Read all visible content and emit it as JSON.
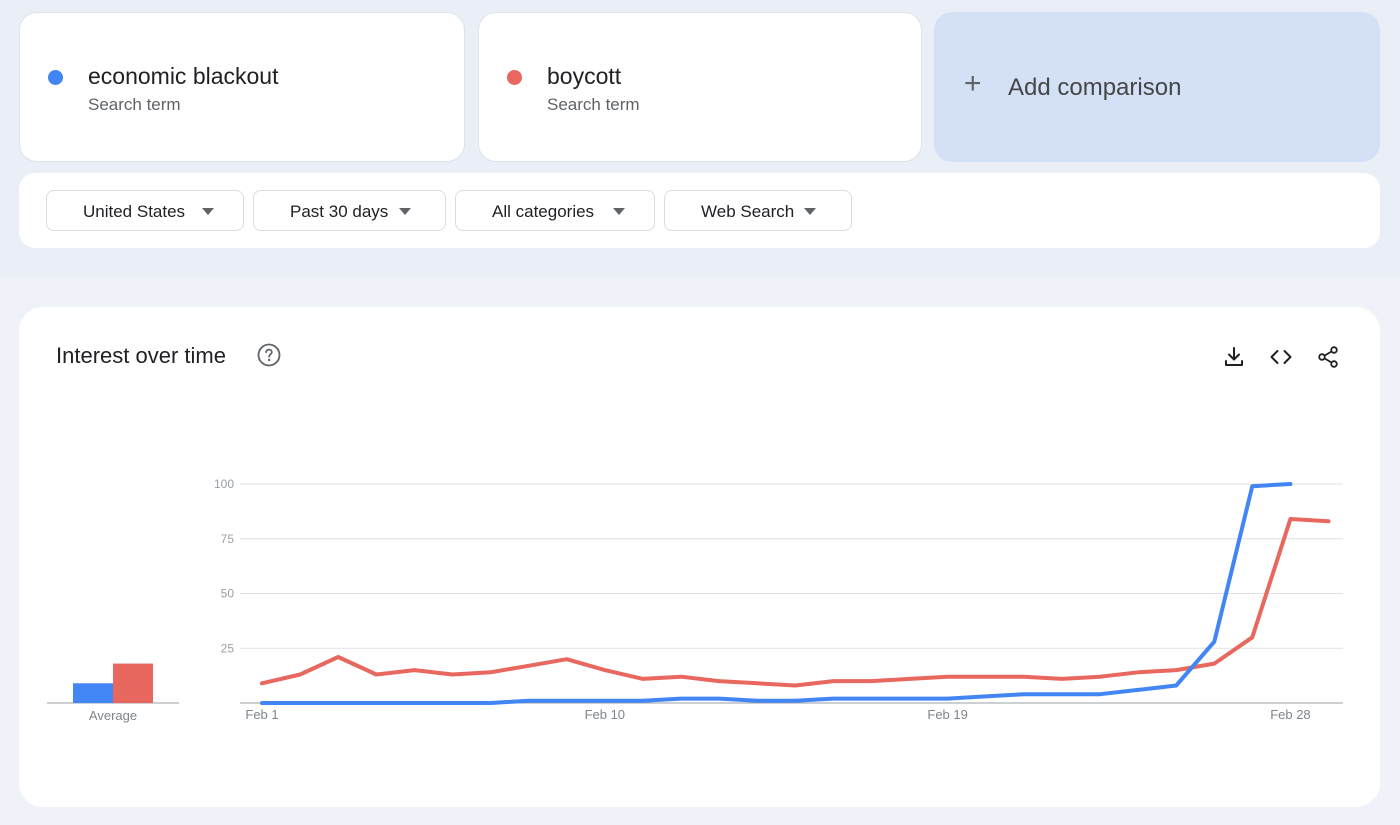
{
  "terms": [
    {
      "name": "economic blackout",
      "type": "Search term",
      "color": "#4285f4"
    },
    {
      "name": "boycott",
      "type": "Search term",
      "color": "#e8675e"
    }
  ],
  "add_comparison": {
    "icon": "plus-icon",
    "label": "Add comparison"
  },
  "filters": [
    {
      "label": "United States"
    },
    {
      "label": "Past 30 days"
    },
    {
      "label": "All categories"
    },
    {
      "label": "Web Search"
    }
  ],
  "chart_panel": {
    "title": "Interest over time",
    "icons": [
      "help-icon",
      "download-icon",
      "embed-icon",
      "share-icon"
    ]
  },
  "chart_data": {
    "type": "line",
    "title": "",
    "xlabel": "",
    "ylabel": "",
    "ylim": [
      0,
      100
    ],
    "yticks": [
      25,
      50,
      75,
      100
    ],
    "grid": true,
    "x": [
      "Feb 1",
      "Feb 2",
      "Feb 3",
      "Feb 4",
      "Feb 5",
      "Feb 6",
      "Feb 7",
      "Feb 8",
      "Feb 9",
      "Feb 10",
      "Feb 11",
      "Feb 12",
      "Feb 13",
      "Feb 14",
      "Feb 15",
      "Feb 16",
      "Feb 17",
      "Feb 18",
      "Feb 19",
      "Feb 20",
      "Feb 21",
      "Feb 22",
      "Feb 23",
      "Feb 24",
      "Feb 25",
      "Feb 26",
      "Feb 27",
      "Feb 28",
      "Mar 1"
    ],
    "xtick_labels": [
      "Feb 1",
      "Feb 10",
      "Feb 19",
      "Feb 28"
    ],
    "series": [
      {
        "name": "economic blackout",
        "color": "#4285f4",
        "values": [
          0,
          0,
          0,
          0,
          0,
          0,
          0,
          1,
          1,
          1,
          1,
          2,
          2,
          1,
          1,
          2,
          2,
          2,
          2,
          3,
          4,
          4,
          4,
          6,
          8,
          28,
          99,
          100,
          null
        ]
      },
      {
        "name": "boycott",
        "color": "#e8675e",
        "values": [
          9,
          13,
          21,
          13,
          15,
          13,
          14,
          17,
          20,
          15,
          11,
          12,
          10,
          9,
          8,
          10,
          10,
          11,
          12,
          12,
          12,
          11,
          12,
          14,
          15,
          18,
          30,
          84,
          83
        ]
      }
    ],
    "average": {
      "label": "Average",
      "values": [
        9,
        18
      ]
    }
  }
}
